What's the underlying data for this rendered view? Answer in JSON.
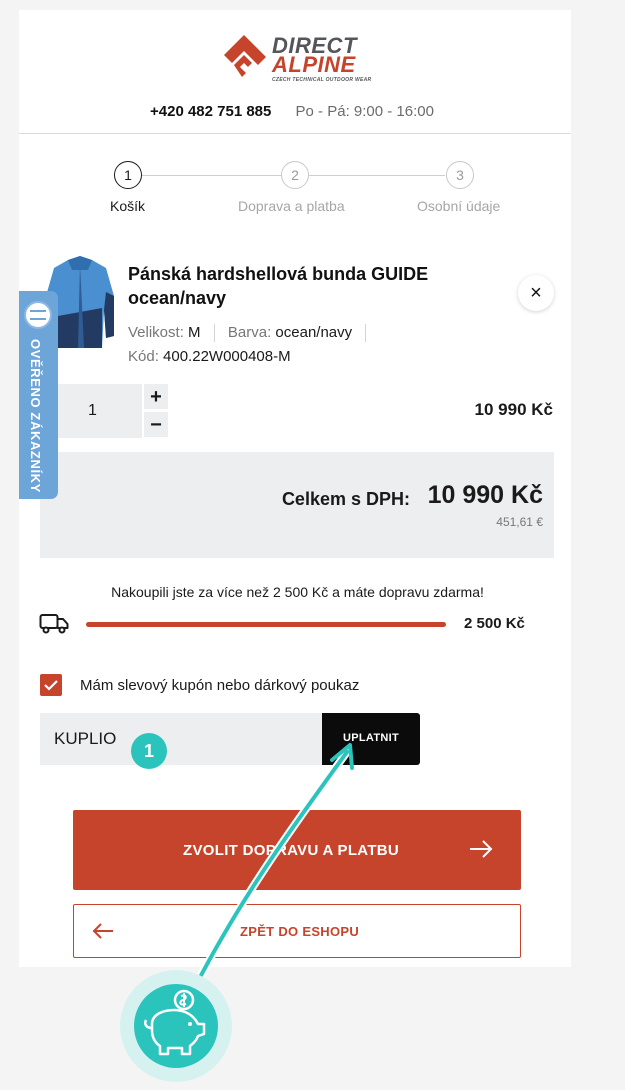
{
  "header": {
    "logo_line1": "DIRECT",
    "logo_line2": "ALPINE",
    "logo_tagline": "CZECH TECHNICAL OUTDOOR WEAR",
    "phone": "+420 482 751 885",
    "hours": "Po - Pá: 9:00 - 16:00"
  },
  "steps": [
    {
      "number": "1",
      "label": "Košík",
      "active": true
    },
    {
      "number": "2",
      "label": "Doprava a platba",
      "active": false
    },
    {
      "number": "3",
      "label": "Osobní údaje",
      "active": false
    }
  ],
  "badge": {
    "text": "OVĚŘENO ZÁKAZNÍKY"
  },
  "cart_item": {
    "name": "Pánská hardshellová bunda GUIDE ocean/navy",
    "size_label": "Velikost:",
    "size_value": "M",
    "color_label": "Barva:",
    "color_value": "ocean/navy",
    "code_label": "Kód:",
    "code_value": "400.22W000408-M",
    "quantity": "1",
    "plus": "+",
    "minus": "−",
    "price": "10 990 Kč",
    "remove_icon": "×"
  },
  "totals": {
    "label": "Celkem s DPH:",
    "value": "10 990 Kč",
    "eur": "451,61 €"
  },
  "shipping": {
    "message": "Nakoupili jste za více než 2 500 Kč a máte dopravu zdarma!",
    "threshold": "2 500 Kč",
    "progress": 1.0
  },
  "coupon": {
    "checkbox_label": "Mám slevový kupón nebo dárkový poukaz",
    "checked": true,
    "input_value": "KUPLIO",
    "apply_label": "UPLATNIT"
  },
  "actions": {
    "primary_label": "ZVOLIT DOPRAVU A PLATBU",
    "secondary_label": "ZPĚT DO ESHOPU"
  },
  "annotation": {
    "number": "1"
  },
  "colors": {
    "accent": "#c5442b",
    "teal": "#2bc4bd",
    "badge_blue": "#6ea5d9",
    "panel_gray": "#eceef0"
  },
  "icons": [
    "direct-alpine-logo-icon",
    "close-icon",
    "truck-icon",
    "checkmark-icon",
    "arrow-right-icon",
    "arrow-left-icon",
    "piggy-bank-icon",
    "verified-seal-icon"
  ]
}
